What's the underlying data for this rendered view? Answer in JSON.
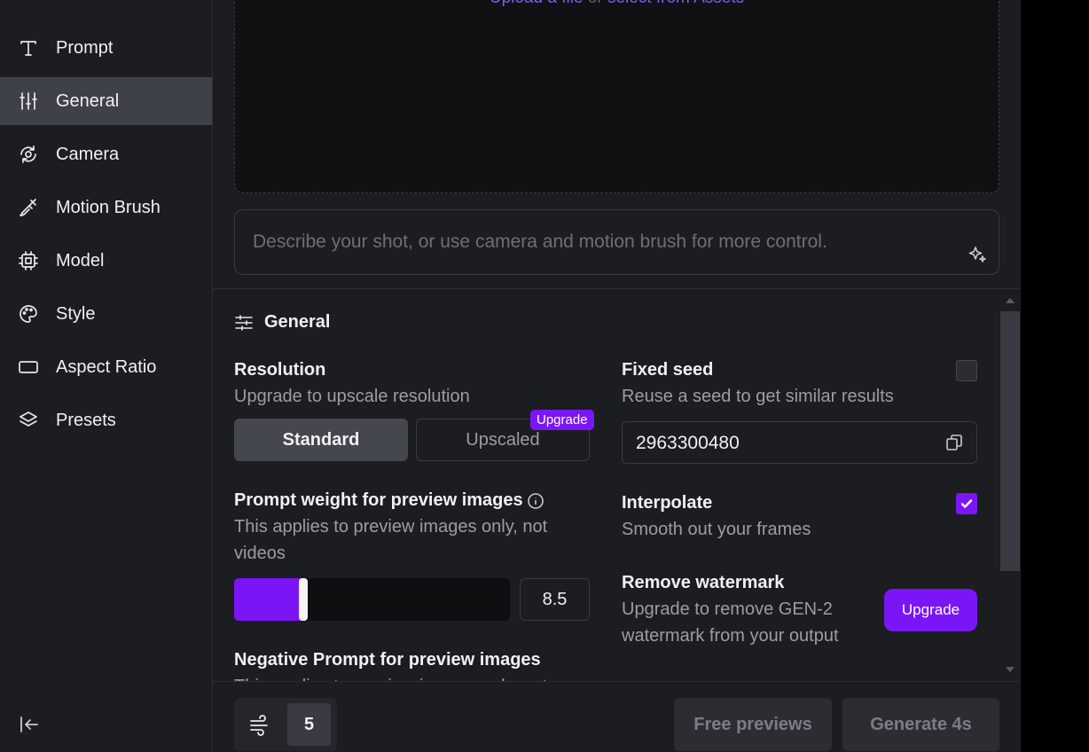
{
  "sidebar": {
    "items": [
      {
        "label": "Prompt",
        "icon": "text-icon"
      },
      {
        "label": "General",
        "icon": "sliders-icon",
        "active": true
      },
      {
        "label": "Camera",
        "icon": "camera-orbit-icon"
      },
      {
        "label": "Motion Brush",
        "icon": "brush-icon"
      },
      {
        "label": "Model",
        "icon": "chip-icon"
      },
      {
        "label": "Style",
        "icon": "palette-icon"
      },
      {
        "label": "Aspect Ratio",
        "icon": "rectangle-icon"
      },
      {
        "label": "Presets",
        "icon": "layers-icon"
      }
    ]
  },
  "upload": {
    "link_upload": "Upload a file",
    "or": "or",
    "link_assets": "select from Assets"
  },
  "prompt": {
    "placeholder": "Describe your shot, or use camera and motion brush for more control."
  },
  "general": {
    "title": "General",
    "resolution": {
      "label": "Resolution",
      "description": "Upgrade to upscale resolution",
      "option_standard": "Standard",
      "option_upscaled": "Upscaled",
      "badge": "Upgrade"
    },
    "prompt_weight": {
      "label": "Prompt weight for preview images",
      "description": "This applies to preview images only, not videos",
      "value": "8.5",
      "fill_fraction": 0.25
    },
    "negative_prompt": {
      "label": "Negative Prompt for preview images",
      "description": "This applies to preview images only, not"
    },
    "fixed_seed": {
      "label": "Fixed seed",
      "description": "Reuse a seed to get similar results",
      "checked": false,
      "seed_value": "2963300480"
    },
    "interpolate": {
      "label": "Interpolate",
      "description": "Smooth out your frames",
      "checked": true
    },
    "watermark": {
      "label": "Remove watermark",
      "description": "Upgrade to remove GEN-2 watermark from your output",
      "button": "Upgrade"
    }
  },
  "footer": {
    "count": "5",
    "free_previews": "Free previews",
    "generate": "Generate 4s"
  },
  "colors": {
    "accent": "#7a16f5",
    "background": "#1c1d21",
    "active_nav": "#3f4149"
  }
}
